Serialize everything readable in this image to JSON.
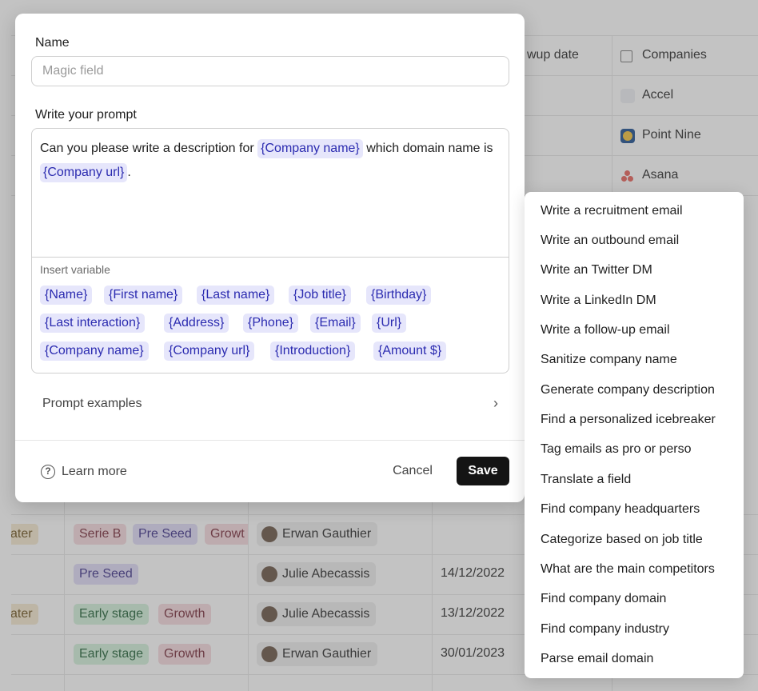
{
  "background_table": {
    "header": {
      "followup_col": "wup date",
      "companies_col": "Companies"
    },
    "companies": [
      "Accel",
      "Point Nine",
      "Asana"
    ],
    "rows": [
      {
        "stage": "ater",
        "tags": [
          "Serie B",
          "Pre Seed",
          "Growt"
        ],
        "owner": "Erwan Gauthier",
        "date": ""
      },
      {
        "stage": "",
        "tags": [
          "Pre Seed"
        ],
        "owner": "Julie Abecassis",
        "date": "14/12/2022"
      },
      {
        "stage": "ater",
        "tags": [
          "Early stage",
          "Growth"
        ],
        "owner": "Julie Abecassis",
        "date": "13/12/2022"
      },
      {
        "stage": "",
        "tags": [
          "Early stage",
          "Growth"
        ],
        "owner": "Erwan Gauthier",
        "date": "30/01/2023"
      }
    ]
  },
  "modal": {
    "name_label": "Name",
    "name_placeholder": "Magic field",
    "prompt_label": "Write your prompt",
    "prompt": {
      "part1": "Can you please write a description for ",
      "var1": "{Company name}",
      "part2": " which domain name is ",
      "var2": "{Company url}",
      "part3": "."
    },
    "insert_variable_label": "Insert variable",
    "variables": [
      "{Name}",
      "{First name}",
      "{Last name}",
      "{Job title}",
      "{Birthday}",
      "{Last interaction}",
      "{Address}",
      "{Phone}",
      "{Email}",
      "{Url}",
      "{Company name}",
      "{Company url}",
      "{Introduction}",
      "{Amount $}"
    ],
    "prompt_examples_label": "Prompt examples",
    "learn_more_label": "Learn more",
    "cancel_label": "Cancel",
    "save_label": "Save"
  },
  "prompt_examples_menu": [
    "Write a recruitment email",
    "Write an outbound email",
    "Write an Twitter DM",
    "Write a LinkedIn DM",
    "Write a follow-up email",
    "Sanitize company name",
    "Generate company description",
    "Find a personalized icebreaker",
    "Tag emails as pro or perso",
    "Translate a field",
    "Find company headquarters",
    "Categorize based on job title",
    "What are the main competitors",
    "Find company domain",
    "Find company industry",
    "Parse email domain"
  ]
}
